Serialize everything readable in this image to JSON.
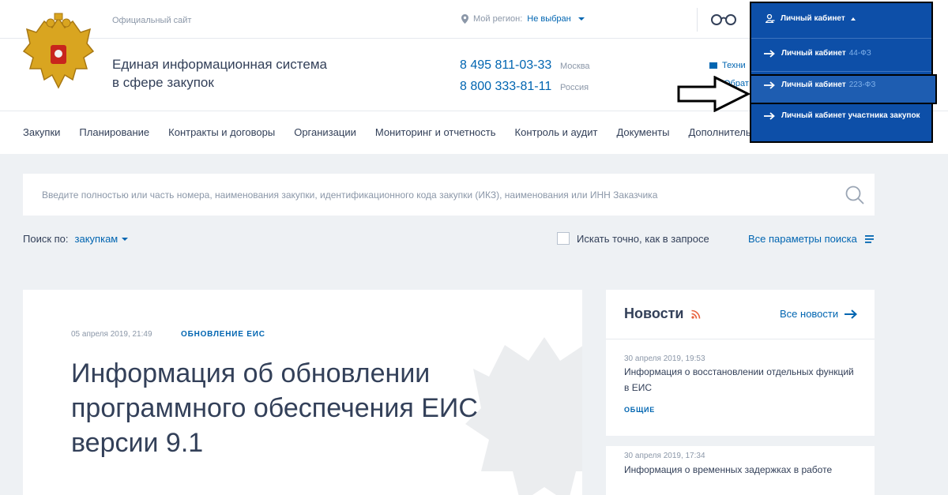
{
  "header": {
    "official_site": "Официальный сайт",
    "title_line1": "Единая информационная система",
    "title_line2": "в сфере закупок",
    "region_label": "Мой регион:",
    "region_value": "Не выбран",
    "phones": [
      {
        "number": "8 495 811-03-33",
        "city": "Москва"
      },
      {
        "number": "8 800 333-81-11",
        "city": "Россия"
      }
    ],
    "support_line1": "Техни",
    "support_line2": "Обрат"
  },
  "nav": [
    "Закупки",
    "Планирование",
    "Контракты и договоры",
    "Организации",
    "Мониторинг и отчетность",
    "Контроль и аудит",
    "Документы",
    "Дополнительна"
  ],
  "search": {
    "placeholder": "Введите полностью или часть номера, наименования закупки, идентификационного кода закупки (ИКЗ), наименования или ИНН Заказчика",
    "by_label": "Поиск по:",
    "by_value": "закупкам",
    "exact_label": "Искать точно, как в запросе",
    "all_params": "Все параметры поиска"
  },
  "article": {
    "date": "05 апреля 2019, 21:49",
    "tag": "ОБНОВЛЕНИЕ ЕИС",
    "title": "Информация об обновлении программного обеспечения ЕИС версии 9.1"
  },
  "news": {
    "title": "Новости",
    "all_link": "Все новости",
    "items": [
      {
        "date": "30 апреля 2019, 19:53",
        "text": "Информация о восстановлении отдельных функций в ЕИС",
        "tag": "ОБЩИЕ"
      },
      {
        "date": "30 апреля 2019, 17:34",
        "text": "Информация о временных задержках в работе",
        "tag": ""
      }
    ]
  },
  "cabinet": {
    "header": "Личный кабинет",
    "items": [
      {
        "label": "Личный кабинет",
        "sub": "44-ФЗ"
      },
      {
        "label": "Личный кабинет",
        "sub": "223-ФЗ"
      },
      {
        "label": "Личный кабинет участника закупок",
        "sub": ""
      }
    ]
  },
  "colors": {
    "accent": "#0065b1",
    "dropdown_bg": "#0d4fa8",
    "page_bg": "#eef1f4"
  }
}
